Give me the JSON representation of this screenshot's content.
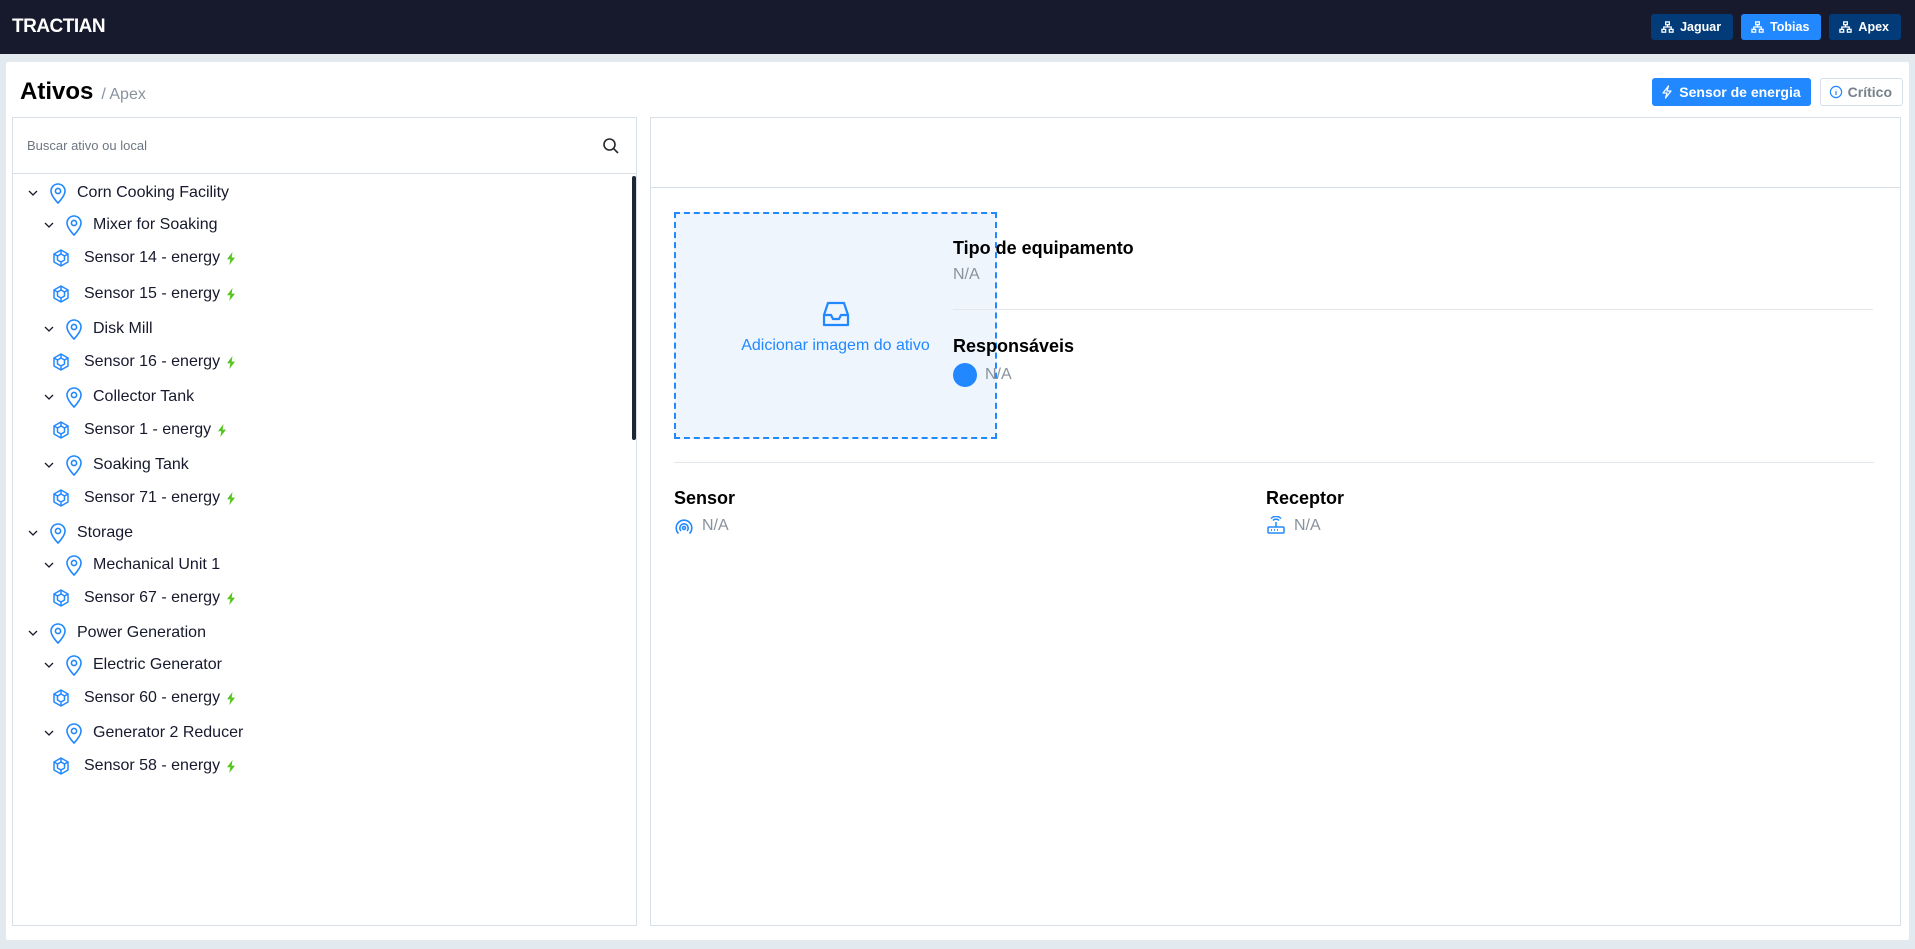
{
  "app": {
    "logo": "TRACTIAN",
    "units": [
      {
        "label": "Jaguar",
        "active": false
      },
      {
        "label": "Tobias",
        "active": true
      },
      {
        "label": "Apex",
        "active": false
      }
    ]
  },
  "header": {
    "title": "Ativos",
    "breadcrumb": "/ Apex",
    "filters": {
      "energy_label": "Sensor de energia",
      "critical_label": "Crítico"
    }
  },
  "tree": {
    "search_placeholder": "Buscar ativo ou local",
    "nodes": [
      {
        "label": "Corn Cooking Facility",
        "type": "location",
        "level": 0
      },
      {
        "label": "Mixer for Soaking",
        "type": "location",
        "level": 1
      },
      {
        "label": "Sensor 14 - energy",
        "type": "component",
        "level": 2
      },
      {
        "label": "Sensor 15 - energy",
        "type": "component",
        "level": 2
      },
      {
        "label": "Disk Mill",
        "type": "location",
        "level": 1
      },
      {
        "label": "Sensor 16 - energy",
        "type": "component",
        "level": 2
      },
      {
        "label": "Collector Tank",
        "type": "location",
        "level": 1
      },
      {
        "label": "Sensor 1 - energy",
        "type": "component",
        "level": 2
      },
      {
        "label": "Soaking Tank",
        "type": "location",
        "level": 1
      },
      {
        "label": "Sensor 71 - energy",
        "type": "component",
        "level": 2
      },
      {
        "label": "Storage",
        "type": "location",
        "level": 0
      },
      {
        "label": "Mechanical Unit 1",
        "type": "location",
        "level": 1
      },
      {
        "label": "Sensor 67 - energy",
        "type": "component",
        "level": 2
      },
      {
        "label": "Power Generation",
        "type": "location",
        "level": 0
      },
      {
        "label": "Electric Generator",
        "type": "location",
        "level": 1
      },
      {
        "label": "Sensor 60 - energy",
        "type": "component",
        "level": 2
      },
      {
        "label": "Generator 2 Reducer",
        "type": "location",
        "level": 1
      },
      {
        "label": "Sensor 58 - energy",
        "type": "component",
        "level": 2
      }
    ]
  },
  "detail": {
    "add_image_label": "Adicionar imagem do ativo",
    "equipment_type_label": "Tipo de equipamento",
    "equipment_type_value": "N/A",
    "responsibles_label": "Responsáveis",
    "responsibles_value": "N/A",
    "sensor_label": "Sensor",
    "sensor_value": "N/A",
    "receptor_label": "Receptor",
    "receptor_value": "N/A"
  },
  "colors": {
    "topbar": "#17192d",
    "accent": "#2188ff",
    "unit_inactive": "#023b78",
    "energy_bolt": "#52c41a"
  }
}
